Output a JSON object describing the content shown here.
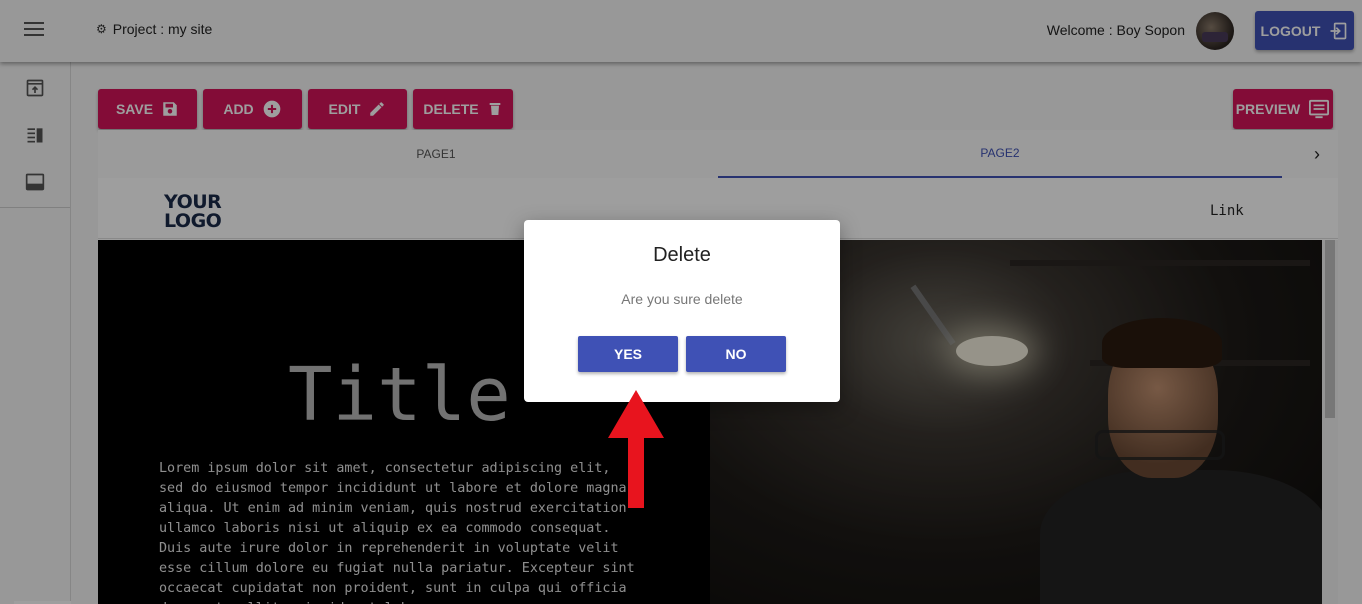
{
  "header": {
    "project_label": "Project : my site",
    "welcome_text": "Welcome : Boy Sopon",
    "logout_label": "LOGOUT",
    "icons": [
      "menu-icon",
      "gear-icon",
      "avatar",
      "logout-icon"
    ]
  },
  "siderail": {
    "icons": [
      "publish-icon",
      "view-list-icon",
      "footer-icon"
    ]
  },
  "toolbar": {
    "save_label": "SAVE",
    "add_label": "ADD",
    "edit_label": "EDIT",
    "delete_label": "DELETE",
    "preview_label": "PREVIEW",
    "button_color": "#d4145a"
  },
  "tabs": [
    {
      "label": "PAGE1",
      "active": false
    },
    {
      "label": "PAGE2",
      "active": true
    }
  ],
  "preview_page": {
    "logo_line1": "YOUR",
    "logo_line2": "LOGO",
    "nav_link": "Link",
    "title": "Title",
    "lorem": "Lorem ipsum dolor sit amet, consectetur adipiscing elit,\nsed do eiusmod tempor incididunt ut labore et dolore magna\naliqua. Ut enim ad minim veniam, quis nostrud exercitation\nullamco laboris nisi ut aliquip ex ea commodo consequat.\nDuis aute irure dolor in reprehenderit in voluptate velit\nesse cillum dolore eu fugiat nulla pariatur. Excepteur sint\noccaecat cupidatat non proident, sunt in culpa qui officia\ndeserunt mollit anim id est laborum."
  },
  "dialog": {
    "title": "Delete",
    "message": "Are you sure delete",
    "yes_label": "YES",
    "no_label": "NO",
    "button_color": "#3f51b5"
  },
  "annotation": {
    "arrow_color": "#e8141e"
  }
}
